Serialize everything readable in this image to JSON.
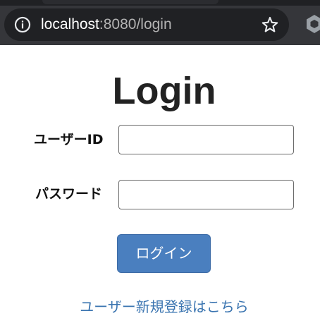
{
  "browser": {
    "url_host": "localhost",
    "url_path": ":8080/login",
    "icons": {
      "site_info": "info-icon",
      "bookmark": "star-icon",
      "extension": "extension-icon"
    },
    "colors": {
      "toolbar": "#35363a",
      "omnibox": "#202124"
    }
  },
  "login": {
    "title": "Login",
    "user_id_label": "ユーザーID",
    "user_id_value": "",
    "password_label": "パスワード",
    "password_value": "",
    "submit_label": "ログイン",
    "register_link": "ユーザー新規登録はこちら"
  },
  "colors": {
    "button": "#4a7fbf",
    "link": "#3a74b0"
  }
}
